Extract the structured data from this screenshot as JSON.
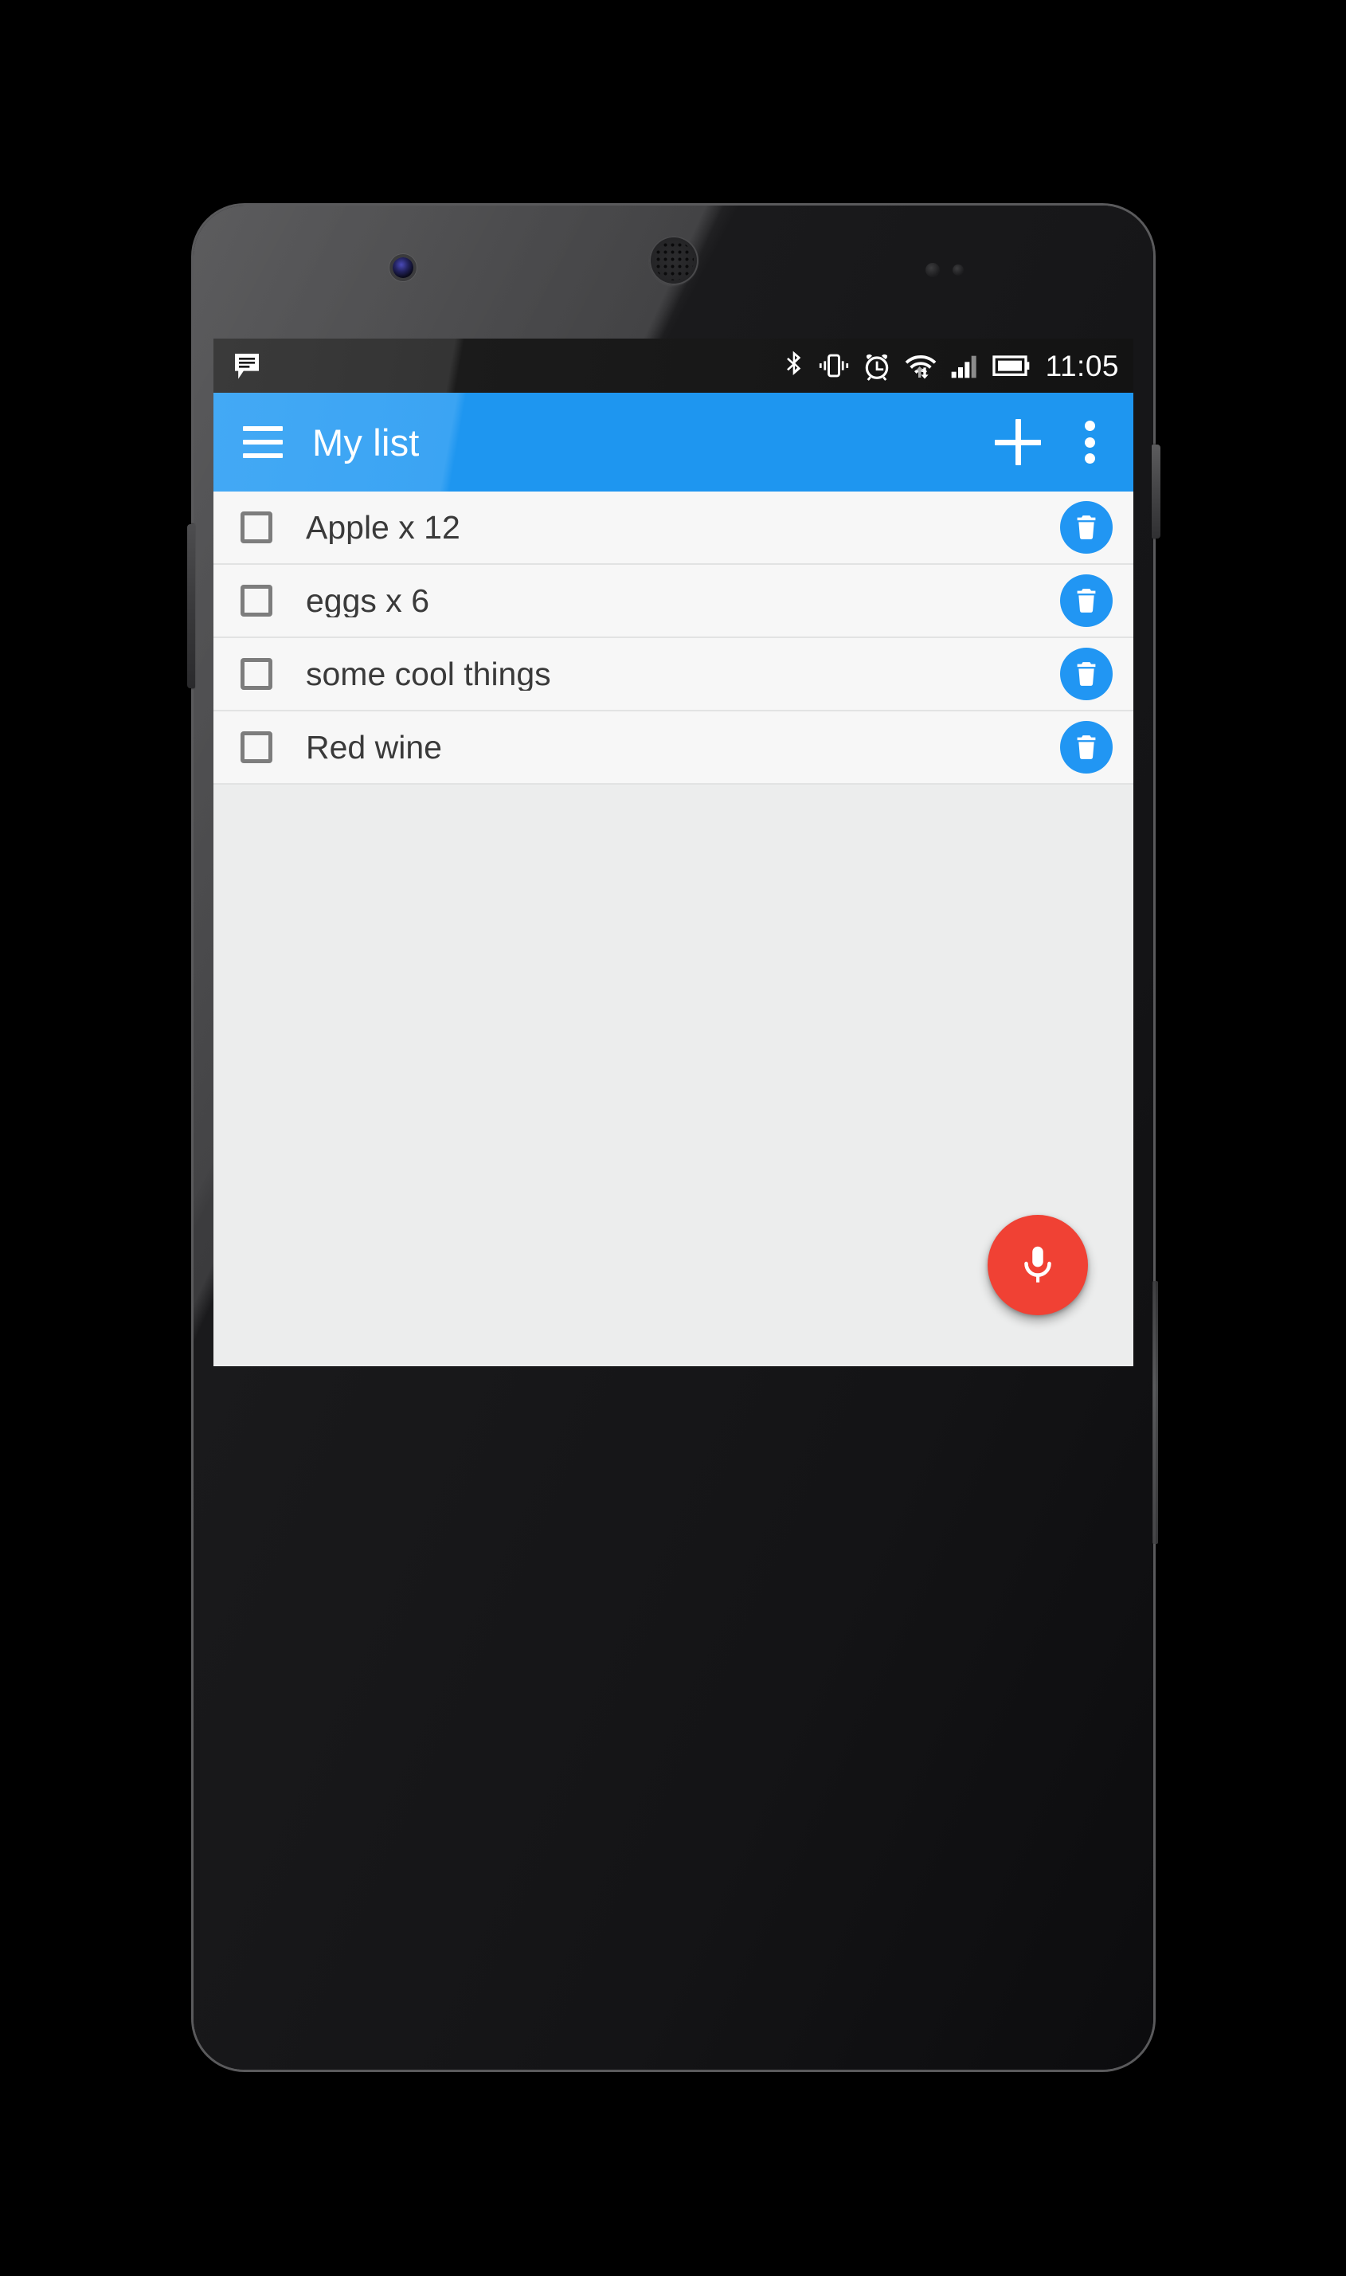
{
  "device": {
    "name": "android-phone",
    "front_camera": "front-camera",
    "earpiece": "earpiece-speaker",
    "sensors": "proximity-sensor",
    "volume_button": "volume-rocker",
    "power_button": "power-button"
  },
  "status_bar": {
    "notification_icon": "message-icon",
    "icons": [
      "bluetooth-icon",
      "vibrate-icon",
      "alarm-icon",
      "wifi-icon",
      "signal-icon",
      "battery-icon"
    ],
    "time": "11:05",
    "background_color": "#1b1b1b"
  },
  "app_bar": {
    "menu_icon": "hamburger-icon",
    "title": "My list",
    "add_icon": "plus-icon",
    "overflow_icon": "more-vert-icon",
    "background_color": "#1e96f0",
    "text_color": "#ffffff"
  },
  "list": {
    "delete_icon": "trash-icon",
    "checkbox_icon": "checkbox-unchecked-icon",
    "accent_color": "#2196f3",
    "items": [
      {
        "label": "Apple x 12",
        "checked": false
      },
      {
        "label": "eggs x 6",
        "checked": false
      },
      {
        "label": "some cool things",
        "checked": false
      },
      {
        "label": "Red wine",
        "checked": false
      }
    ]
  },
  "fab": {
    "icon": "microphone-icon",
    "color": "#f04134"
  }
}
